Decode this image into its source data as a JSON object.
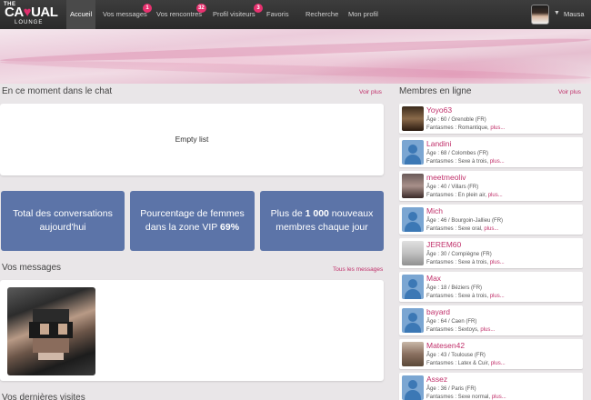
{
  "logo": {
    "the": "THE",
    "casual": "CASUAL",
    "lounge": "LOUNGE"
  },
  "nav": {
    "accueil": "Accueil",
    "messages": "Vos messages",
    "messages_badge": "1",
    "rencontres": "Vos rencontres",
    "rencontres_badge": "32",
    "visiteurs": "Profil visiteurs",
    "visiteurs_badge": "3",
    "favoris": "Favoris",
    "recherche": "Recherche",
    "profil": "Mon profil",
    "user": "Mausa"
  },
  "chat": {
    "title": "En ce moment dans le chat",
    "voir": "Voir plus",
    "empty": "Empty list"
  },
  "stats": [
    {
      "text": "Total des conversations aujourd'hui"
    },
    {
      "pre": "Pourcentage de femmes dans la zone VIP ",
      "bold": "69%"
    },
    {
      "pre": "Plus de ",
      "bold": "1 000",
      "post": " nouveaux membres chaque jour"
    }
  ],
  "messages": {
    "title": "Vos messages",
    "voir": "Tous les messages"
  },
  "visits": {
    "title": "Vos dernières visites"
  },
  "members": {
    "title": "Membres en ligne",
    "voir": "Voir plus",
    "list": [
      {
        "name": "Yoyo63",
        "info": "Âge : 60 / Grenoble (FR)",
        "fantasmes": "Fantasmes : Romantique, ",
        "plus": "plus..."
      },
      {
        "name": "Landini",
        "info": "Âge : 68 / Colombes (FR)",
        "fantasmes": "Fantasmes : Sexe à trois, ",
        "plus": "plus..."
      },
      {
        "name": "meetmeoliv",
        "info": "Âge : 40 / Villars (FR)",
        "fantasmes": "Fantasmes : En plein air, ",
        "plus": "plus..."
      },
      {
        "name": "Mich",
        "info": "Âge : 46 / Bourgoin-Jallieu (FR)",
        "fantasmes": "Fantasmes : Sexe oral, ",
        "plus": "plus..."
      },
      {
        "name": "JEREM60",
        "info": "Âge : 30 / Compiègne (FR)",
        "fantasmes": "Fantasmes : Sexe à trois, ",
        "plus": "plus..."
      },
      {
        "name": "Max",
        "info": "Âge : 18 / Béziers (FR)",
        "fantasmes": "Fantasmes : Sexe à trois, ",
        "plus": "plus..."
      },
      {
        "name": "bayard",
        "info": "Âge : 64 / Caen (FR)",
        "fantasmes": "Fantasmes : Sextoys, ",
        "plus": "plus..."
      },
      {
        "name": "Matesen42",
        "info": "Âge : 43 / Toulouse (FR)",
        "fantasmes": "Fantasmes : Latex & Cuir, ",
        "plus": "plus..."
      },
      {
        "name": "Assez",
        "info": "Âge : 36 / Paris (FR)",
        "fantasmes": "Fantasmes : Sexe normal, ",
        "plus": "plus..."
      }
    ]
  }
}
